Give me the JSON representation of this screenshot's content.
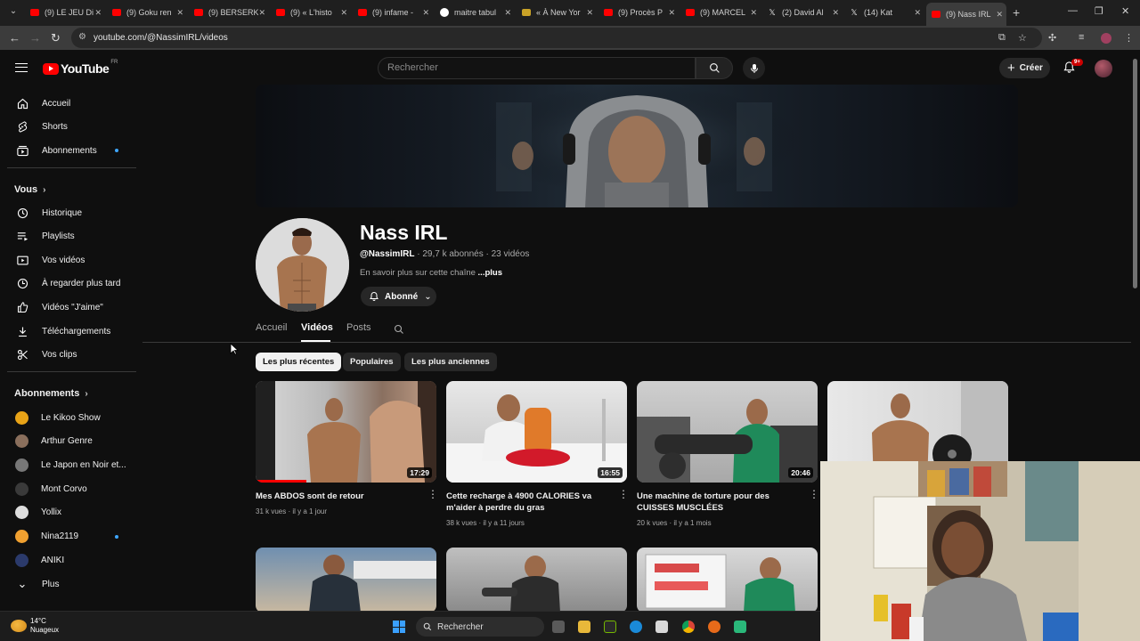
{
  "browser": {
    "tabs": [
      {
        "title": "(9) LE JEU Di",
        "favicon": "youtube"
      },
      {
        "title": "(9) Goku ren",
        "favicon": "youtube"
      },
      {
        "title": "(9) BERSERK",
        "favicon": "youtube"
      },
      {
        "title": "(9) « L'histo",
        "favicon": "youtube"
      },
      {
        "title": "(9) infame -",
        "favicon": "youtube"
      },
      {
        "title": "maitre tabul",
        "favicon": "google"
      },
      {
        "title": "« À New Yor",
        "favicon": "news"
      },
      {
        "title": "(9) Procès P",
        "favicon": "youtube"
      },
      {
        "title": "(9) MARCEL",
        "favicon": "youtube"
      },
      {
        "title": "(2) David Al",
        "favicon": "x"
      },
      {
        "title": "(14) Kat",
        "favicon": "x"
      },
      {
        "title": "(9) Nass IRL",
        "favicon": "youtube",
        "active": true
      }
    ],
    "url": "youtube.com/@NassimIRL/videos"
  },
  "masthead": {
    "logo_text": "YouTube",
    "country_code": "FR",
    "search_placeholder": "Rechercher",
    "create_label": "Créer",
    "notifications_badge": "9+"
  },
  "sidebar": {
    "main": [
      {
        "label": "Accueil",
        "icon": "home-icon"
      },
      {
        "label": "Shorts",
        "icon": "shorts-icon"
      },
      {
        "label": "Abonnements",
        "icon": "subscriptions-icon",
        "dot": true
      }
    ],
    "you_heading": "Vous",
    "you": [
      {
        "label": "Historique",
        "icon": "history-icon"
      },
      {
        "label": "Playlists",
        "icon": "playlists-icon"
      },
      {
        "label": "Vos vidéos",
        "icon": "your-videos-icon"
      },
      {
        "label": "À regarder plus tard",
        "icon": "watch-later-icon"
      },
      {
        "label": "Vidéos \"J'aime\"",
        "icon": "liked-icon"
      },
      {
        "label": "Téléchargements",
        "icon": "downloads-icon"
      },
      {
        "label": "Vos clips",
        "icon": "clips-icon"
      }
    ],
    "subs_heading": "Abonnements",
    "subscriptions": [
      {
        "label": "Le Kikoo Show",
        "color": "#e8a317"
      },
      {
        "label": "Arthur Genre",
        "color": "#8a6f5c"
      },
      {
        "label": "Le Japon en Noir et...",
        "color": "#777777"
      },
      {
        "label": "Mont Corvo",
        "color": "#3a3a3a"
      },
      {
        "label": "Yollix",
        "color": "#dddddd"
      },
      {
        "label": "Nina2119",
        "color": "#f0a030",
        "dot": true
      },
      {
        "label": "ANIKI",
        "color": "#2b3a6b"
      }
    ],
    "more_label": "Plus"
  },
  "channel": {
    "name": "Nass IRL",
    "handle": "@NassimIRL",
    "subscribers": " · 29,7 k abonnés · 23 vidéos",
    "about": "En savoir plus sur cette chaîne ",
    "about_more": "...plus",
    "subscribe_label": "Abonné",
    "tabs": [
      "Accueil",
      "Vidéos",
      "Posts"
    ],
    "chips": [
      "Les plus récentes",
      "Populaires",
      "Les plus anciennes"
    ]
  },
  "videos": [
    {
      "title": "Mes ABDOS sont de retour",
      "meta": "31 k vues · il y a 1 jour",
      "duration": "17:29",
      "progress": 0.28
    },
    {
      "title": "Cette recharge à 4900 CALORIES va m'aider à perdre du gras",
      "meta": "38 k vues · il y a 11 jours",
      "duration": "16:55"
    },
    {
      "title": "Une machine de torture pour des CUISSES MUSCLÉES",
      "meta": "20 k vues · il y a 1 mois",
      "duration": "20:46"
    },
    {
      "title": "",
      "meta": "",
      "duration": ""
    }
  ],
  "taskbar": {
    "temperature": "14°C",
    "condition": "Nuageux",
    "search_label": "Rechercher"
  }
}
